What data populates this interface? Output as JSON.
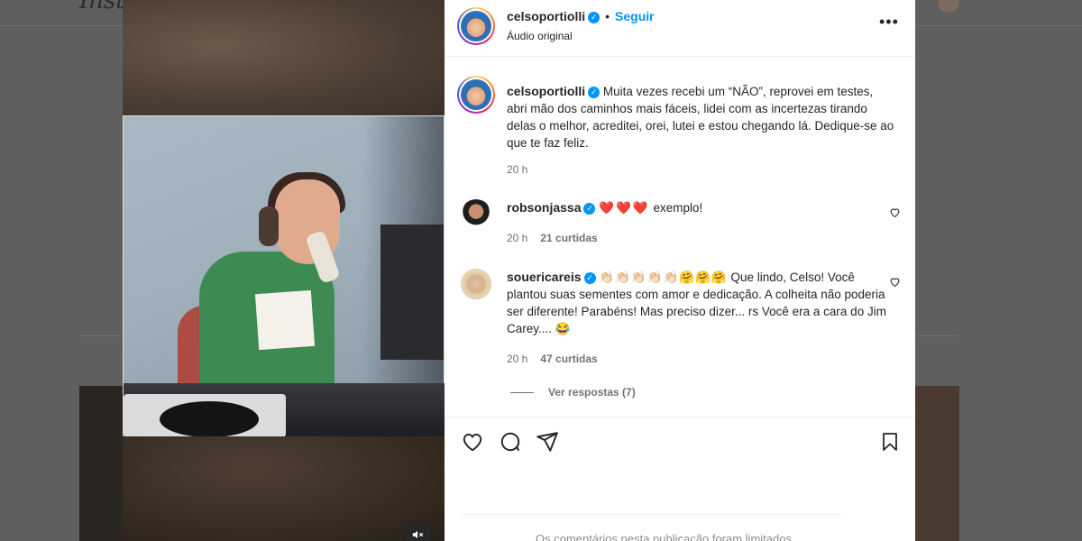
{
  "backdrop": {
    "logo_text": "Insta"
  },
  "media": {
    "mute_icon": "speaker-muted-icon"
  },
  "post": {
    "username": "celsoportiolli",
    "follow_label": "Seguir",
    "audio_label": "Áudio original",
    "separator": "•",
    "more_label": "•••"
  },
  "caption": {
    "username": "celsoportiolli",
    "text": "Muita vezes recebi um “NÃO”, reprovei em testes, abri mão dos caminhos mais fáceis, lidei com as incertezas tirando delas o melhor, acreditei, orei, lutei e estou chegando lá. Dedique-se ao que te faz feliz.",
    "time": "20 h"
  },
  "comments": [
    {
      "username": "robsonjassa",
      "hearts": "❤️❤️❤️",
      "text": "exemplo!",
      "time": "20 h",
      "likes": "21 curtidas"
    },
    {
      "username": "souericareis",
      "emojis": "👏🏻👏🏻👏🏻👏🏻👏🏻🤗🤗🤗",
      "text": "Que lindo, Celso! Você plantou suas sementes com amor e dedicação. A colheita não poderia ser diferente! Parabéns! Mas preciso dizer... rs Você era a cara do Jim Carey.... 😂",
      "time": "20 h",
      "likes": "47 curtidas",
      "replies_label": "Ver respostas (7)"
    }
  ],
  "footer": {
    "limited_text": "Os comentários nesta publicação foram limitados."
  }
}
